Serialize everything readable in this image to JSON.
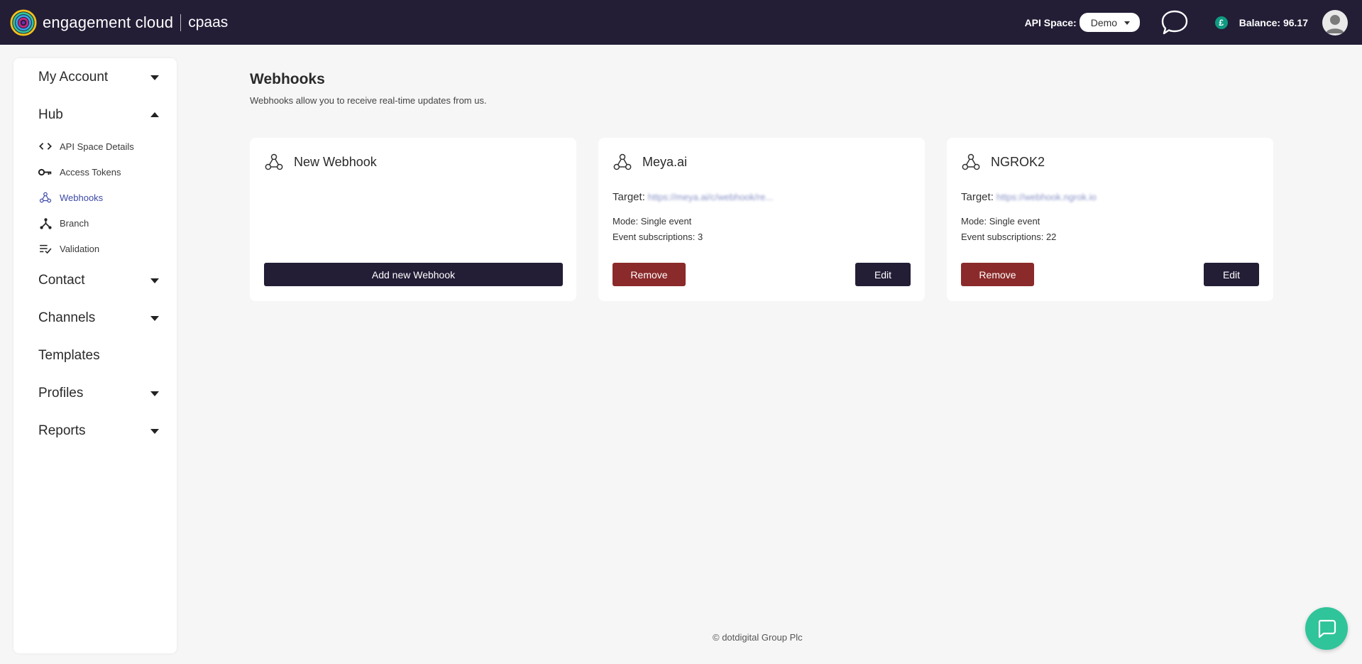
{
  "header": {
    "brand": "engagement cloud",
    "product": "cpaas",
    "api_space_label": "API Space:",
    "api_space_value": "Demo",
    "currency_symbol": "£",
    "balance": "Balance: 96.17"
  },
  "sidebar": {
    "sections": [
      {
        "label": "My Account",
        "state": "collapsed"
      },
      {
        "label": "Hub",
        "state": "expanded"
      },
      {
        "label": "Contact",
        "state": "collapsed"
      },
      {
        "label": "Channels",
        "state": "collapsed"
      },
      {
        "label": "Templates",
        "state": "none"
      },
      {
        "label": "Profiles",
        "state": "collapsed"
      },
      {
        "label": "Reports",
        "state": "collapsed"
      }
    ],
    "hub_items": [
      {
        "label": "API Space Details",
        "icon": "code-icon"
      },
      {
        "label": "Access Tokens",
        "icon": "key-icon"
      },
      {
        "label": "Webhooks",
        "icon": "webhook-icon",
        "active": true
      },
      {
        "label": "Branch",
        "icon": "branch-icon"
      },
      {
        "label": "Validation",
        "icon": "validation-icon"
      }
    ]
  },
  "main": {
    "title": "Webhooks",
    "subtitle": "Webhooks allow you to receive real-time updates from us."
  },
  "cards": [
    {
      "title": "New Webhook",
      "action_label": "Add new Webhook"
    },
    {
      "title": "Meya.ai",
      "target_label": "Target:",
      "target_value": "https://meya.ai/c/webhook/re...",
      "mode": "Mode: Single event",
      "subscriptions": "Event subscriptions: 3",
      "remove_label": "Remove",
      "edit_label": "Edit"
    },
    {
      "title": "NGROK2",
      "target_label": "Target:",
      "target_value": "https://webhook.ngrok.io",
      "mode": "Mode: Single event",
      "subscriptions": "Event subscriptions: 22",
      "remove_label": "Remove",
      "edit_label": "Edit"
    }
  ],
  "footer": {
    "text": "© dotdigital Group Plc"
  },
  "colors": {
    "topbar": "#231d36",
    "primary_button": "#231d36",
    "danger_button": "#8b2a2a",
    "active_link": "#3d4aa8",
    "chat_fab": "#2fc49a"
  }
}
